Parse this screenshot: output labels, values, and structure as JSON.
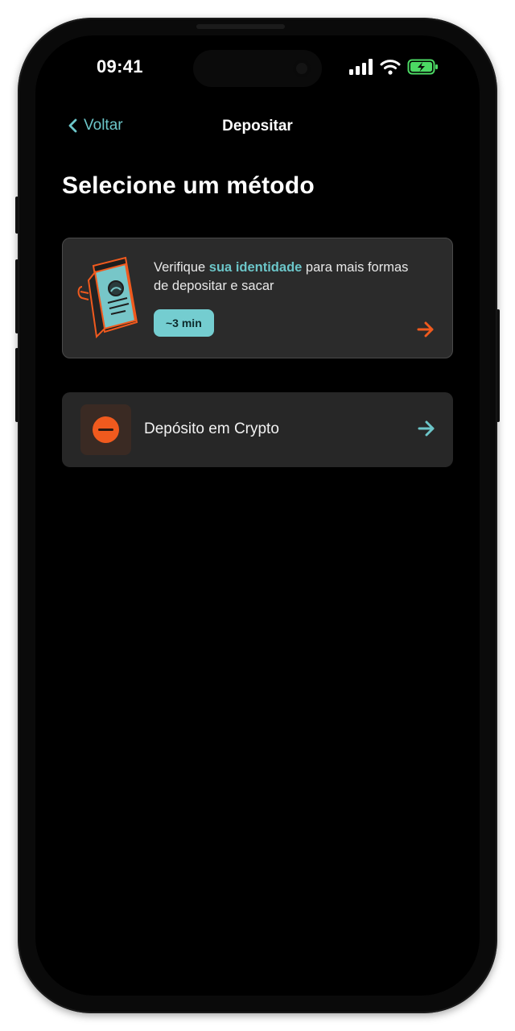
{
  "status_bar": {
    "time": "09:41",
    "icons": [
      "signal-icon",
      "wifi-icon",
      "battery-charging-icon"
    ],
    "battery_color": "#4cd964"
  },
  "nav": {
    "back_label": "Voltar",
    "title": "Depositar"
  },
  "section_title": "Selecione um método",
  "verify_card": {
    "text_before": "Verifique ",
    "text_highlight": "sua identidade",
    "text_after": " para mais formas de depositar e sacar",
    "badge": "~3 min",
    "illustration": "id-document-icon",
    "arrow_icon": "arrow-right-icon"
  },
  "crypto_option": {
    "label": "Depósito em Crypto",
    "icon": "crypto-coin-icon",
    "arrow_icon": "arrow-right-icon"
  },
  "colors": {
    "accent_teal": "#6cc6c9",
    "accent_orange": "#f05a1e",
    "card_bg": "#2b2b2b",
    "screen_bg": "#000000"
  }
}
